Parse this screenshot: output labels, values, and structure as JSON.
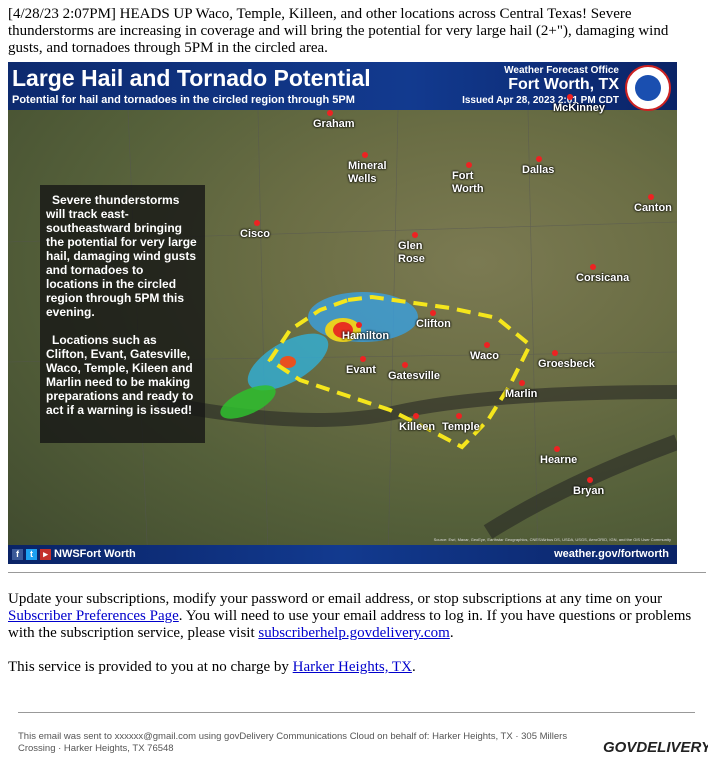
{
  "intro": "[4/28/23 2:07PM] HEADS UP Waco, Temple, Killeen, and other locations across Central Texas! Severe thunderstorms are increasing in coverage and will bring the potential for very large hail (2+\"), damaging wind gusts, and tornadoes through 5PM in the circled area.",
  "graphic": {
    "title": "Large Hail and Tornado Potential",
    "subtitle": "Potential for hail and tornadoes in the circled region through 5PM",
    "office_label": "Weather Forecast Office",
    "office": "Fort Worth, TX",
    "issued": "Issued Apr 28, 2023 2:01 PM CDT",
    "logo_text": "NATIONAL WEATHER SERVICE",
    "textbox": [
      "Severe thunderstorms will track east-southeastward bringing the potential for very large hail, damaging wind gusts and tornadoes to locations in the circled region through 5PM this evening.",
      "Locations such as Clifton, Evant, Gatesville, Waco, Temple, Kileen and Marlin need to be making preparations and ready to act if a warning is issued!"
    ],
    "cities": [
      "Graham",
      "Mineral Wells",
      "Fort Worth",
      "Dallas",
      "McKinney",
      "Canton",
      "Cisco",
      "Glen Rose",
      "Corsicana",
      "Clifton",
      "Hamilton",
      "Waco",
      "Groesbeck",
      "Evant",
      "Gatesville",
      "Marlin",
      "Killeen",
      "Temple",
      "Hearne",
      "Bryan"
    ],
    "source": "Source: Esri, Maxar, GeoEye, Earthstar Geographics, CNES/Airbus DS, USDA, USGS, AeroGRID, IGN, and the GIS User Community",
    "social": "NWSFort Worth",
    "url": "weather.gov/fortworth",
    "outline_color": "#f5e61c"
  },
  "body": {
    "p1_a": "Update your subscriptions, modify your password or email address, or stop subscriptions at any time on your ",
    "p1_link1": "Subscriber Preferences Page",
    "p1_b": ". You will need to use your email address to log in. If you have questions or problems with the subscription service, please visit ",
    "p1_link2": "subscriberhelp.govdelivery.com",
    "p1_c": ".",
    "p2_a": "This service is provided to you at no charge by ",
    "p2_link": "Harker Heights, TX",
    "p2_b": "."
  },
  "footer": {
    "text": "This email was sent to xxxxxx@gmail.com using govDelivery Communications Cloud on behalf of: Harker Heights, TX · 305 Millers Crossing · Harker Heights, TX 76548",
    "logo": "GOVDELIVERY"
  }
}
